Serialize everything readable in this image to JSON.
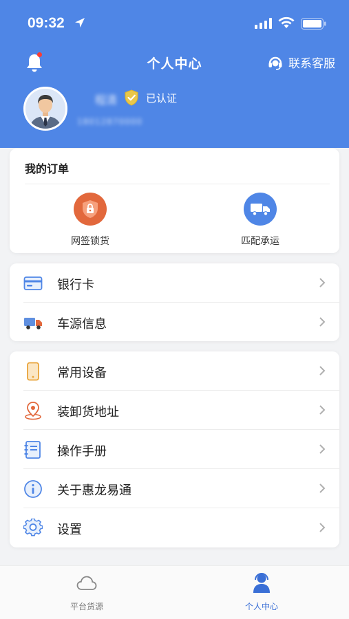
{
  "status_bar": {
    "time": "09:32"
  },
  "header": {
    "title": "个人中心",
    "customer_service": "联系客服"
  },
  "profile": {
    "name": "程清",
    "phone": "18012870000",
    "verified_label": "已认证"
  },
  "orders": {
    "title": "我的订单",
    "items": [
      {
        "label": "网签锁货",
        "icon": "lock-shield-icon",
        "color": "#e2683c"
      },
      {
        "label": "匹配承运",
        "icon": "truck-icon",
        "color": "#4f86e6"
      }
    ]
  },
  "menu_group_1": [
    {
      "label": "银行卡",
      "icon": "bank-card-icon"
    },
    {
      "label": "车源信息",
      "icon": "truck-icon"
    }
  ],
  "menu_group_2": [
    {
      "label": "常用设备",
      "icon": "phone-device-icon"
    },
    {
      "label": "装卸货地址",
      "icon": "location-pin-icon"
    },
    {
      "label": "操作手册",
      "icon": "manual-book-icon"
    },
    {
      "label": "关于惠龙易通",
      "icon": "info-icon"
    },
    {
      "label": "设置",
      "icon": "gear-icon"
    }
  ],
  "tabbar": [
    {
      "label": "平台货源",
      "icon": "cloud-icon",
      "active": false
    },
    {
      "label": "个人中心",
      "icon": "user-icon",
      "active": true
    }
  ],
  "colors": {
    "primary": "#4f86e6",
    "accent_orange": "#e2683c",
    "background": "#f2f3f5"
  }
}
